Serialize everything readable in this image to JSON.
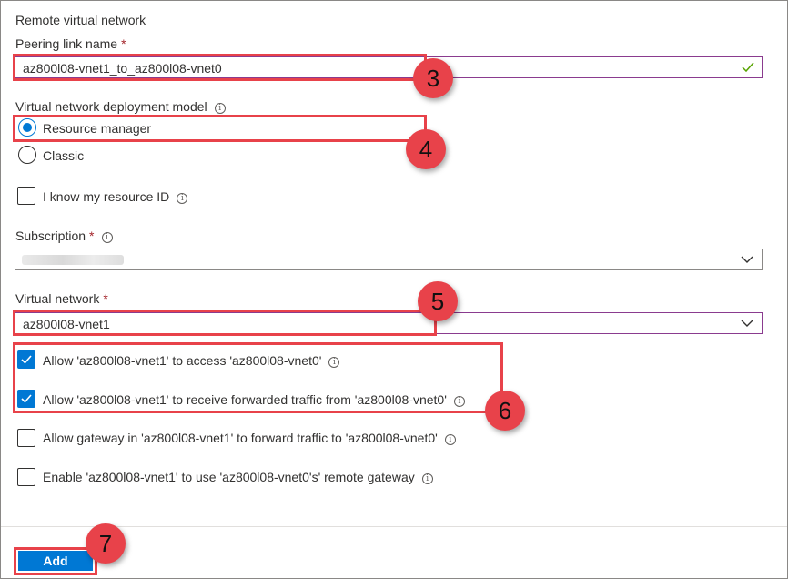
{
  "section_title": "Remote virtual network",
  "peering": {
    "label": "Peering link name",
    "required_mark": "*",
    "value": "az800l08-vnet1_to_az800l08-vnet0"
  },
  "deployment_model": {
    "label": "Virtual network deployment model",
    "options": [
      {
        "label": "Resource manager",
        "selected": true
      },
      {
        "label": "Classic",
        "selected": false
      }
    ]
  },
  "resource_id_checkbox": {
    "label": "I know my resource ID",
    "checked": false
  },
  "subscription": {
    "label": "Subscription",
    "required_mark": "*",
    "value": ""
  },
  "virtual_network": {
    "label": "Virtual network",
    "required_mark": "*",
    "value": "az800l08-vnet1"
  },
  "options": [
    {
      "label": "Allow 'az800l08-vnet1' to access 'az800l08-vnet0'",
      "checked": true
    },
    {
      "label": "Allow 'az800l08-vnet1' to receive forwarded traffic from 'az800l08-vnet0'",
      "checked": true
    },
    {
      "label": "Allow gateway in 'az800l08-vnet1' to forward traffic to 'az800l08-vnet0'",
      "checked": false
    },
    {
      "label": "Enable 'az800l08-vnet1' to use 'az800l08-vnet0's' remote gateway",
      "checked": false
    }
  ],
  "add_button": "Add",
  "badges": [
    "3",
    "4",
    "5",
    "6",
    "7"
  ],
  "colors": {
    "accent": "#0078d4",
    "callout": "#e8424a",
    "required": "#a4262c",
    "valid_border": "#8a3b8f",
    "check_ok": "#57a300"
  },
  "icons": {
    "info": "info-circle-icon",
    "valid": "checkmark-icon",
    "dropdown": "chevron-down-icon"
  }
}
